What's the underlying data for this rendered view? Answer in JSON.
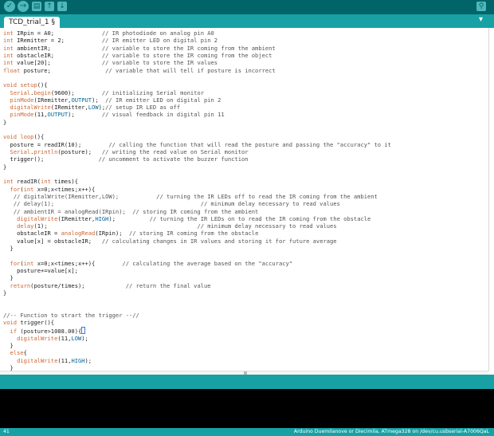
{
  "toolbar": {
    "buttons": [
      {
        "name": "verify",
        "icon": "check-icon"
      },
      {
        "name": "upload",
        "icon": "arrow-right-icon"
      },
      {
        "name": "new",
        "icon": "new-file-icon"
      },
      {
        "name": "open",
        "icon": "arrow-up-icon"
      },
      {
        "name": "save",
        "icon": "arrow-down-icon"
      }
    ],
    "serial_monitor_icon": "magnifier-icon"
  },
  "tab": {
    "label": "TCD_trial_1 §",
    "menu_icon": "tab-menu-icon"
  },
  "code_lines": [
    "int IRpin = A0;              // IR photodiode on analog pin A0",
    "int IRemitter = 2;           // IR emitter LED on digital pin 2",
    "int ambientIR;               // variable to store the IR coming from the ambient",
    "int obstacleIR;              // variable to store the IR coming from the object",
    "int value[20];               // variable to store the IR values",
    "float posture;                // variable that will tell if posture is incorrect",
    "",
    "void setup(){",
    "  Serial.begin(9600);        // initializing Serial monitor",
    "  pinMode(IRemitter,OUTPUT);  // IR emitter LED on digital pin 2",
    "  digitalWrite(IRemitter,LOW);// setup IR LED as off",
    "  pinMode(11,OUTPUT);        // visual feedback in digital pin 11",
    "}",
    "",
    "void loop(){",
    "  posture = readIR(10);        // calling the function that will read the posture and passing the \"accuracy\" to it",
    "  Serial.println(posture);   // writing the read value on Serial monitor",
    "  trigger();                // uncomment to activate the buzzer function",
    "}",
    "",
    "int readIR(int times){",
    "  for(int x=0;x<times;x++){",
    "   // digitalWrite(IRemitter,LOW);           // turning the IR LEDs off to read the IR coming from the ambient",
    "   // delay(1);                                           // minimum delay necessary to read values",
    "   // ambientIR = analogRead(IRpin);  // storing IR coming from the ambient",
    "    digitalWrite(IRemitter,HIGH);          // turning the IR LEDs on to read the IR coming from the obstacle",
    "    delay(1);                                            // minimum delay necessary to read values",
    "    obstacleIR = analogRead(IRpin);  // storing IR coming from the obstacle",
    "    value[x] = obstacleIR;   // calculating changes in IR values and storing it for future average",
    "  }",
    "",
    "  for(int x=0;x<times;x++){        // calculating the average based on the \"accuracy\"",
    "    posture+=value[x];",
    "  }",
    "  return(posture/times);            // return the final value",
    "}",
    "",
    "",
    "//-- Function to strart the trigger --//",
    "void trigger(){",
    "  if (posture>1088.00){",
    "    digitalWrite(11,LOW);",
    "  }",
    "  else{",
    "    digitalWrite(11,HIGH);",
    "  }",
    "}"
  ],
  "status": {
    "line_number": "41",
    "board": "Arduino Duemilanove or Diecimila, ATmega328 on /dev/cu.usbserial-A7006QaL"
  },
  "colors": {
    "toolbar_bg": "#006468",
    "tabbar_bg": "#17a1a5",
    "keyword": "#cc6633",
    "constant": "#006699",
    "console_bg": "#000000"
  }
}
